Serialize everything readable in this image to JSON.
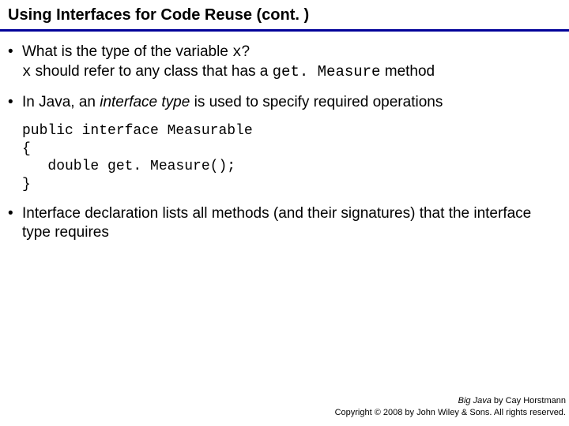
{
  "header": {
    "title": "Using Interfaces for Code Reuse  (cont. )"
  },
  "bullets": {
    "b1_line1a": "What is the type of the variable ",
    "b1_line1_code": "x",
    "b1_line1b": "?",
    "b1_line2_code": "x",
    "b1_line2a": " should refer to any class that has a ",
    "b1_line2_code2": "get. Measure",
    "b1_line2b": " method",
    "b2a": "In Java, an ",
    "b2_italic": "interface type",
    "b2b": " is used to specify required operations",
    "b3": "Interface declaration lists all methods (and their signatures) that the interface type requires"
  },
  "code": {
    "l1": "public interface Measurable",
    "l2": "{",
    "l3": "   double get. Measure();",
    "l4": "}"
  },
  "footer": {
    "book": "Big Java",
    "by": " by Cay Horstmann",
    "copyright": "Copyright © 2008 by John Wiley & Sons.  All rights reserved."
  }
}
